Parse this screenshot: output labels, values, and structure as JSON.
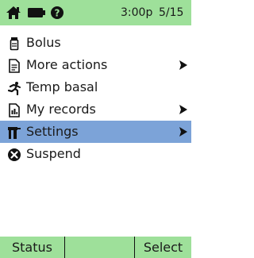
{
  "status_bar": {
    "home_icon": "home-icon",
    "battery_icon": "battery-icon",
    "alert_icon": "question-icon",
    "time": "3:00p",
    "date": "5/15"
  },
  "menu": {
    "items": [
      {
        "label": "Bolus",
        "icon": "bolus-vial-icon",
        "has_submenu": false,
        "selected": false
      },
      {
        "label": "More actions",
        "icon": "more-actions-icon",
        "has_submenu": true,
        "selected": false
      },
      {
        "label": "Temp basal",
        "icon": "running-person-icon",
        "has_submenu": false,
        "selected": false
      },
      {
        "label": "My records",
        "icon": "records-icon",
        "has_submenu": true,
        "selected": false
      },
      {
        "label": "Settings",
        "icon": "settings-tool-icon",
        "has_submenu": true,
        "selected": true
      },
      {
        "label": "Suspend",
        "icon": "suspend-icon",
        "has_submenu": false,
        "selected": false
      }
    ]
  },
  "softkeys": {
    "left": "Status",
    "middle": "",
    "right": "Select"
  },
  "colors": {
    "bar_green": "#9ee09a",
    "selection_blue": "#7ca3d8"
  }
}
